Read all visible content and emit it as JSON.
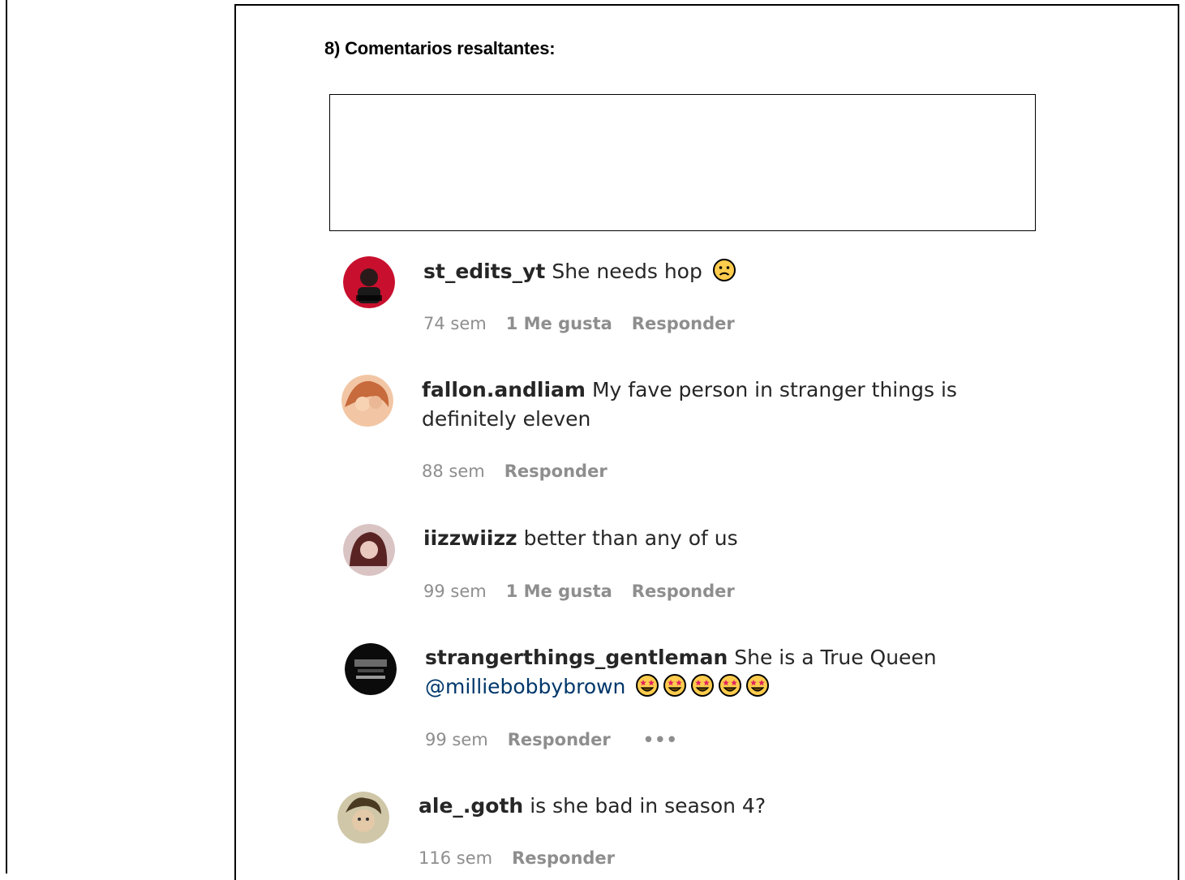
{
  "section": {
    "heading": "8) Comentarios resaltantes:"
  },
  "comments": [
    {
      "username": "st_edits_yt",
      "text": "She needs hop",
      "emoji": "frowning-face",
      "time": "74 sem",
      "likes": "1 Me gusta",
      "reply": "Responder",
      "avatar_color": "#c8102e"
    },
    {
      "username": "fallon.andliam",
      "text": "My fave person in stranger things is definitely eleven",
      "time": "88 sem",
      "reply": "Responder",
      "avatar_color": "#d88a5c"
    },
    {
      "username": "iizzwiizz",
      "text": "better than any of us",
      "time": "99 sem",
      "likes": "1 Me gusta",
      "reply": "Responder",
      "avatar_color": "#7a3b3b"
    },
    {
      "username": "strangerthings_gentleman",
      "text": "She is a True Queen",
      "mention": "@milliebobbybrown",
      "emoji": "star-struck-face",
      "emoji_count": 5,
      "time": "99 sem",
      "reply": "Responder",
      "more": "•••",
      "avatar_color": "#111111"
    },
    {
      "username": "ale_.goth",
      "text": "is she bad in season 4?",
      "time": "116 sem",
      "reply": "Responder",
      "avatar_color": "#8a7a5a"
    }
  ]
}
